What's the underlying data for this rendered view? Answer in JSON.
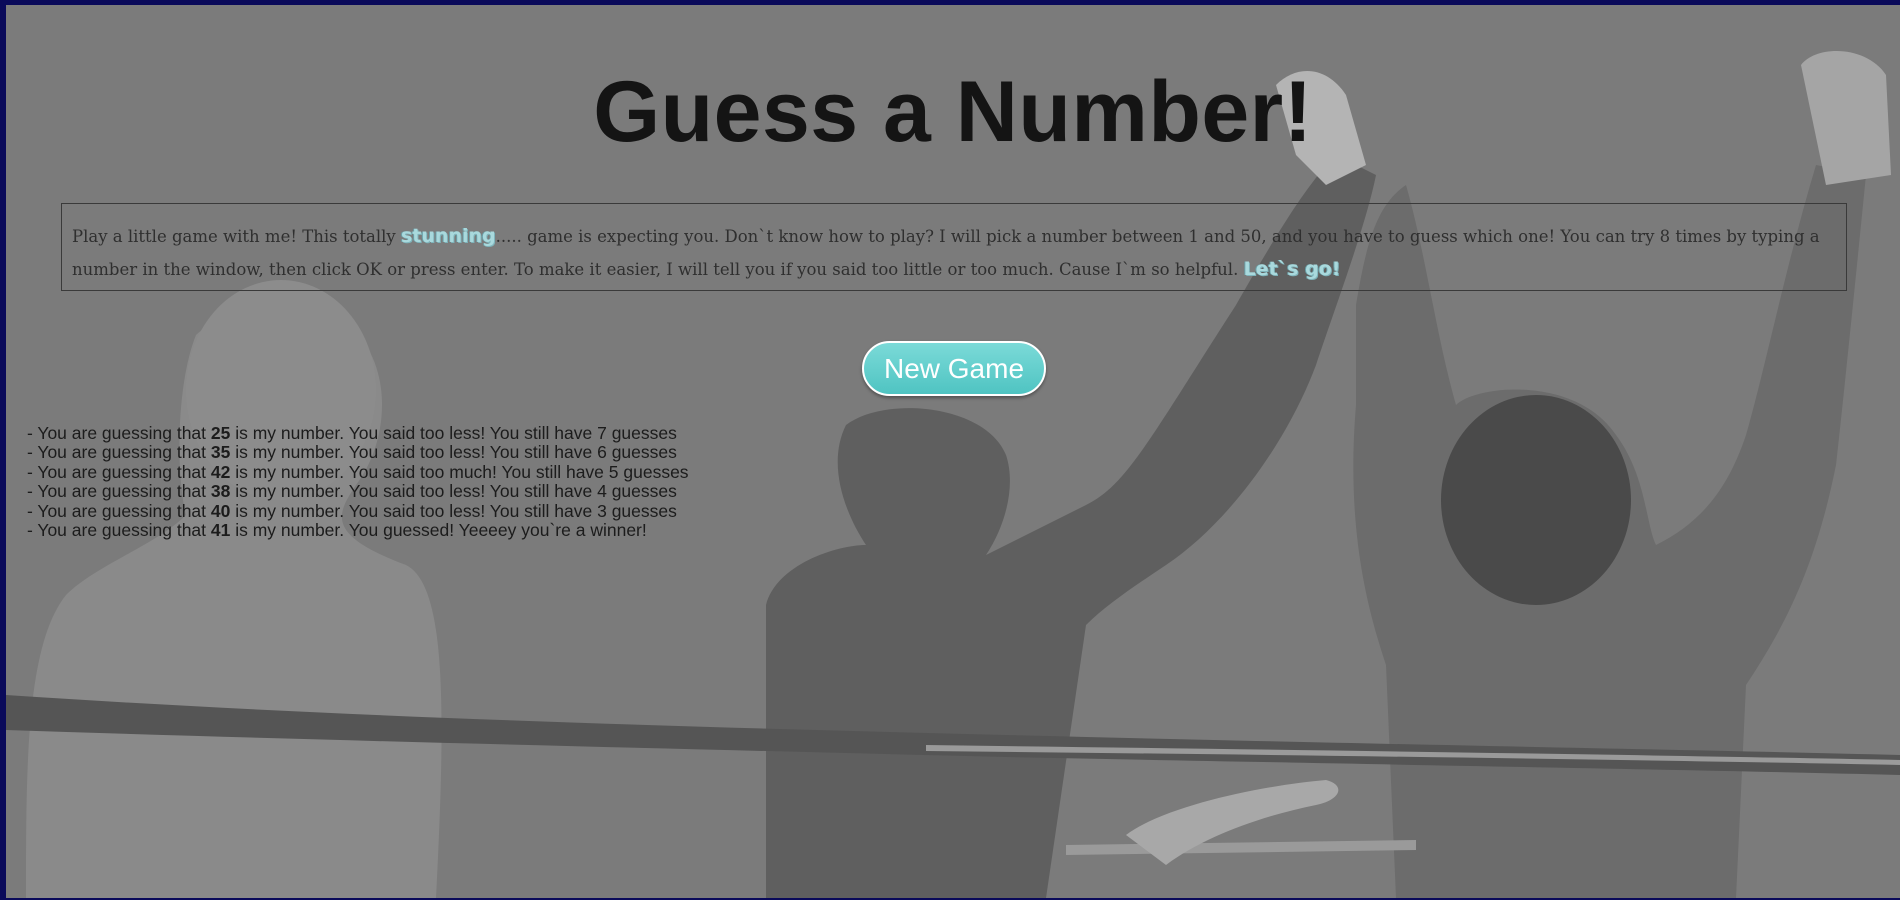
{
  "header": {
    "title": "Guess a Number!"
  },
  "intro": {
    "text_1": "Play a little game with me! This totally ",
    "accent_word": "stunning",
    "text_2": "..... game is expecting you. Don`t know how to play? I will pick a number between 1 and 50, and you have to guess which one! You can try 8 times by typing a number in the window, then click OK or press enter. To make it easier, I will tell you if you said too little or too much. Cause I`m so helpful. ",
    "accent_go": "Let`s go!"
  },
  "controls": {
    "new_game_label": "New Game"
  },
  "guesses": [
    {
      "prefix": "- You are guessing that ",
      "number": "25",
      "suffix": " is my number. You said too less! You still have 7 guesses"
    },
    {
      "prefix": "- You are guessing that ",
      "number": "35",
      "suffix": " is my number. You said too less! You still have 6 guesses"
    },
    {
      "prefix": "- You are guessing that ",
      "number": "42",
      "suffix": " is my number. You said too much! You still have 5 guesses"
    },
    {
      "prefix": "- You are guessing that ",
      "number": "38",
      "suffix": " is my number. You said too less! You still have 4 guesses"
    },
    {
      "prefix": "- You are guessing that ",
      "number": "40",
      "suffix": " is my number. You said too less! You still have 3 guesses"
    },
    {
      "prefix": "- You are guessing that ",
      "number": "41",
      "suffix": " is my number. You guessed! Yeeeey you`re a winner!"
    }
  ],
  "colors": {
    "page_background": "#7b7b7b",
    "button_gradient_top": "#7bdad8",
    "button_gradient_bottom": "#4fc4c2",
    "accent_text": "#a9d9dd",
    "window_frame": "#0a0a5a"
  }
}
